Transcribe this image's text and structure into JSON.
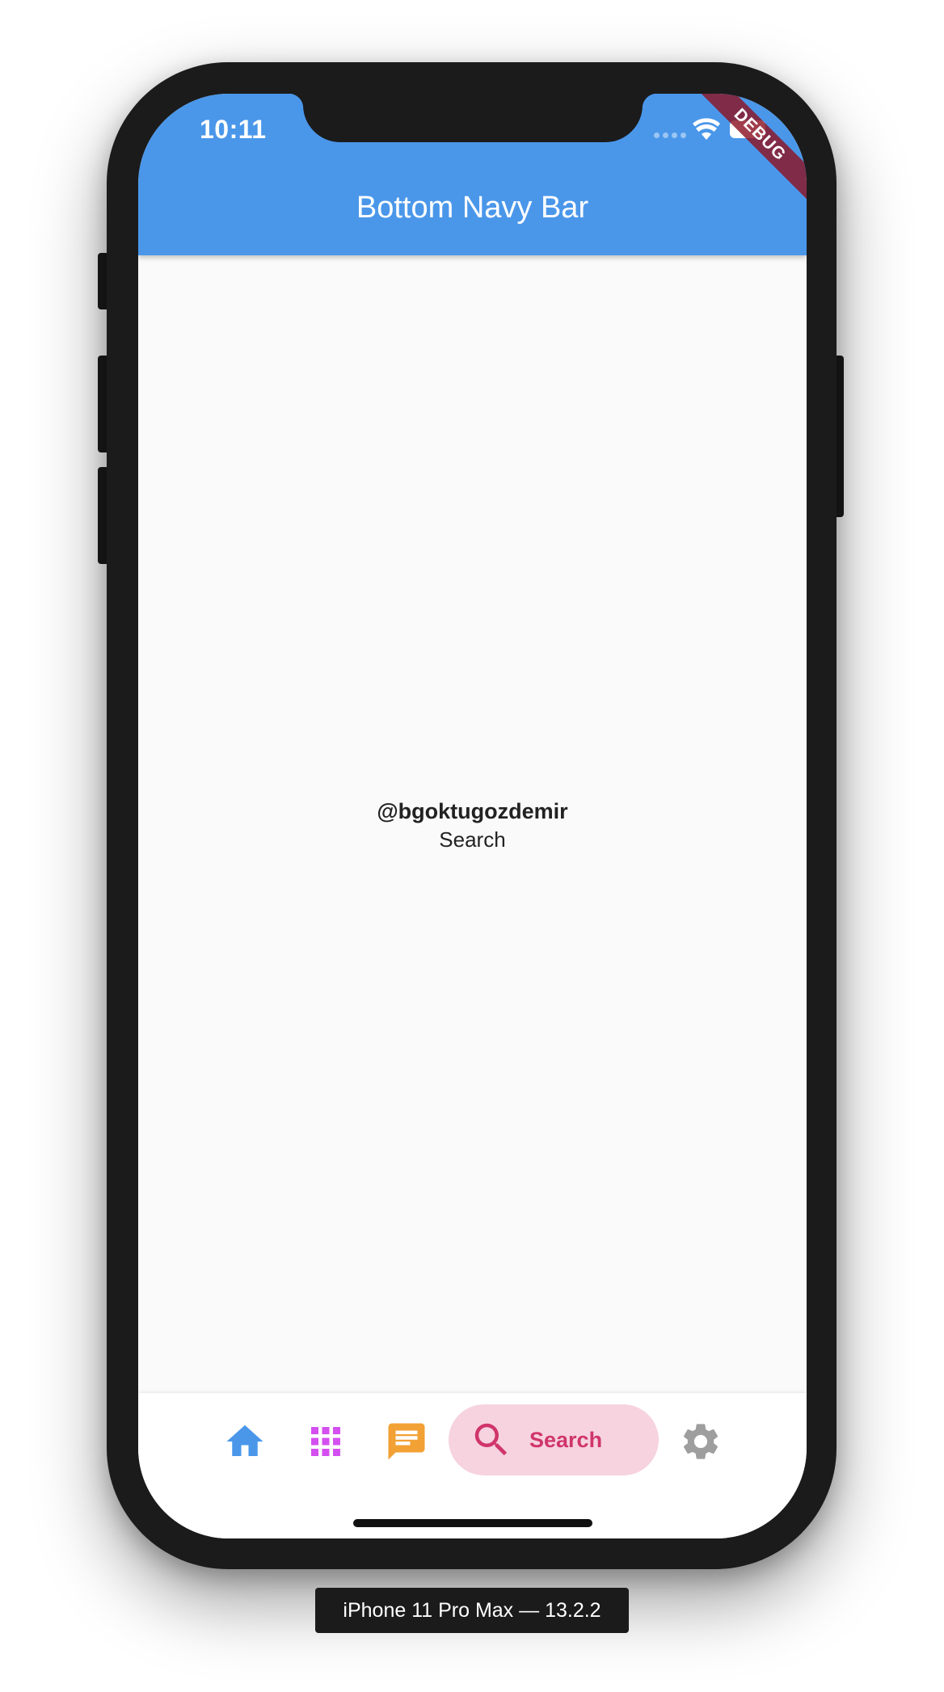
{
  "status_bar": {
    "time": "10:11"
  },
  "app_bar": {
    "title": "Bottom Navy Bar",
    "color": "#4a97ea"
  },
  "debug_banner": "DEBUG",
  "content": {
    "handle": "@bgoktugozdemir",
    "page_label": "Search"
  },
  "bottom_nav": {
    "items": [
      {
        "icon": "home-icon",
        "color": "#4a97ea"
      },
      {
        "icon": "apps-grid-icon",
        "color": "#d44ff0"
      },
      {
        "icon": "message-icon",
        "color": "#f2a134"
      },
      {
        "icon": "search-icon",
        "label": "Search",
        "color": "#d0356b",
        "active": true
      },
      {
        "icon": "settings-icon",
        "color": "#9e9e9e"
      }
    ]
  },
  "device": {
    "label": "iPhone 11 Pro Max — 13.2.2"
  }
}
